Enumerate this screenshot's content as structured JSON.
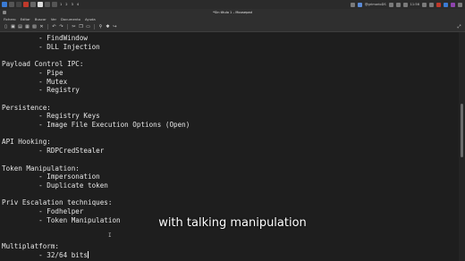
{
  "panel": {
    "workspaces": [
      "1",
      "2",
      "3",
      "4"
    ],
    "user": "@grimorioDS",
    "clock": "11:56"
  },
  "window": {
    "title": "*Sin título 1 – Mousepad"
  },
  "menu": [
    "Fichero",
    "Editar",
    "Buscar",
    "Ver",
    "Documento",
    "Ayuda"
  ],
  "toolbar": {
    "icons": [
      "new-document-icon",
      "new-window-icon",
      "open-icon",
      "save-icon",
      "save-as-icon",
      "close-icon",
      "undo-icon",
      "redo-icon",
      "cut-icon",
      "copy-icon",
      "paste-icon",
      "search-icon",
      "search-replace-icon",
      "goto-icon"
    ]
  },
  "editor": {
    "lines": [
      "         - FindWindow",
      "         - DLL Injection",
      "",
      "Payload Control IPC:",
      "         - Pipe",
      "         - Mutex",
      "         - Registry",
      "",
      "Persistence:",
      "         - Registry Keys",
      "         - Image File Execution Options (Open)",
      "",
      "API Hooking:",
      "         - RDPCredStealer",
      "",
      "Token Manipulation:",
      "         - Impersonation",
      "         - Duplicate token",
      "",
      "Priv Escalation techniques:",
      "         - Fodhelper",
      "         - Token Manipulation",
      "",
      "",
      "Multiplatform:",
      "         - 32/64 bits"
    ]
  },
  "caption": "with talking manipulation"
}
